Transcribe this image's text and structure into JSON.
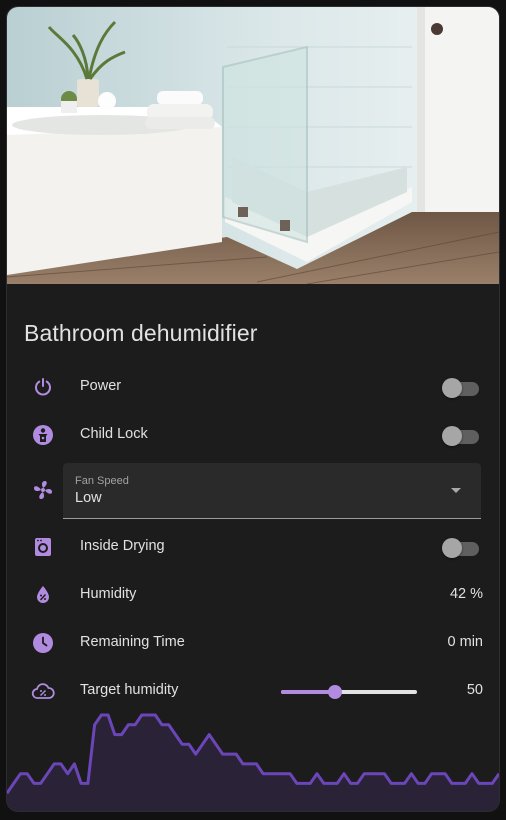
{
  "card": {
    "title": "Bathroom dehumidifier",
    "accent_color": "#b08be0",
    "photo": "bathroom-photo"
  },
  "rows": {
    "power": {
      "label": "Power",
      "icon": "power-icon",
      "state": "off"
    },
    "child_lock": {
      "label": "Child Lock",
      "icon": "child-lock-icon",
      "state": "off"
    },
    "fan_speed": {
      "label": "Fan Speed",
      "value": "Low",
      "icon": "fan-icon"
    },
    "inside_drying": {
      "label": "Inside Drying",
      "icon": "washing-machine-icon",
      "state": "off"
    },
    "humidity": {
      "label": "Humidity",
      "value": "42 %",
      "icon": "water-percent-icon"
    },
    "remaining_time": {
      "label": "Remaining Time",
      "value": "0 min",
      "icon": "clock-icon"
    },
    "target_humidity": {
      "label": "Target humidity",
      "value": "50",
      "icon": "cloud-percent-icon",
      "slider_fraction": 0.4
    }
  },
  "history": {
    "line_color": "#6b46b8",
    "fill_color": "#2a2236",
    "values": [
      1,
      2,
      3,
      3,
      2,
      2,
      3,
      4,
      4,
      3,
      4,
      2,
      2,
      8,
      9,
      9,
      7,
      7,
      8,
      8,
      9,
      9,
      9,
      8,
      8,
      7,
      6,
      6,
      5,
      6,
      7,
      6,
      5,
      5,
      5,
      4,
      4,
      4,
      3,
      3,
      3,
      3,
      3,
      2,
      2,
      2,
      3,
      2,
      2,
      2,
      3,
      2,
      2,
      3,
      3,
      3,
      3,
      2,
      2,
      2,
      3,
      2,
      2,
      3,
      3,
      3,
      2,
      2,
      2,
      3,
      2,
      2,
      2,
      3
    ]
  }
}
